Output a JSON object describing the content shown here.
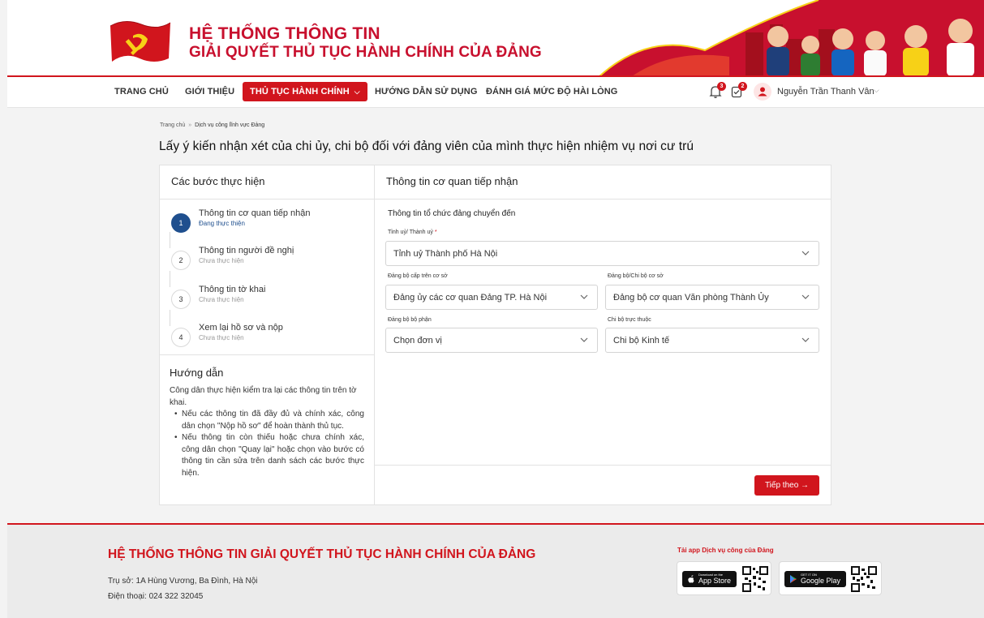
{
  "header": {
    "brand_line1": "HỆ THỐNG THÔNG TIN",
    "brand_line2": "GIẢI QUYẾT THỦ TỤC HÀNH CHÍNH CỦA ĐẢNG"
  },
  "nav": {
    "items": [
      "TRANG CHỦ",
      "GIỚI THIỆU",
      "THỦ TỤC HÀNH CHÍNH",
      "HƯỚNG DẪN SỬ DỤNG",
      "ĐÁNH GIÁ MỨC ĐỘ HÀI LÒNG"
    ],
    "notifications_count": "3",
    "tasks_count": "2",
    "user_name": "Nguyễn Trần Thanh Vân"
  },
  "breadcrumb": {
    "home": "Trang chủ",
    "separator": "»",
    "current": "Dịch vụ công lĩnh vực Đảng"
  },
  "page_title": "Lấy ý kiến nhận xét của chi ủy, chi bộ đối với đảng viên của mình thực hiện nhiệm vụ nơi cư trú",
  "steps": {
    "heading": "Các bước thực hiện",
    "items": [
      {
        "num": "1",
        "title": "Thông tin cơ quan tiếp nhận",
        "status": "Đang thực thiện"
      },
      {
        "num": "2",
        "title": "Thông tin người đề nghị",
        "status": "Chưa thực hiện"
      },
      {
        "num": "3",
        "title": "Thông tin tờ khai",
        "status": "Chưa thực hiện"
      },
      {
        "num": "4",
        "title": "Xem lại hồ sơ và nộp",
        "status": "Chưa thực hiện"
      }
    ]
  },
  "guide": {
    "title": "Hướng dẫn",
    "intro": "Công dân thực hiện kiểm tra lại các thông tin trên tờ khai.",
    "bullets": [
      "Nếu các thông tin đã đầy đủ và chính xác, công dân chọn \"Nộp hồ sơ\" để hoàn thành thủ tục.",
      "Nếu thông tin còn thiếu hoặc chưa chính xác, công dân chọn \"Quay lại\" hoặc chọn vào bước có thông tin cần sửa trên danh sách các bước thực hiện."
    ]
  },
  "form": {
    "heading": "Thông tin cơ quan tiếp nhận",
    "section_title": "Thông tin tổ chức đảng chuyển đến",
    "fields": {
      "tinh_uy": {
        "label": "Tỉnh uỷ/ Thành uỷ",
        "required": "*",
        "value": "Tỉnh uỷ Thành phố Hà Nội"
      },
      "dang_bo_cap_tren": {
        "label": "Đảng bộ cấp trên cơ sở",
        "value": "Đảng ủy các cơ quan Đảng TP. Hà Nội"
      },
      "dang_bo_co_so": {
        "label": "Đảng bộ/Chi bộ cơ sở",
        "value": "Đảng bộ cơ quan Văn phòng Thành Ủy"
      },
      "dang_bo_bo_phan": {
        "label": "Đảng bộ bộ phận",
        "value": "Chọn đơn vị"
      },
      "chi_bo": {
        "label": "Chi bộ trực thuộc",
        "value": "Chi bộ Kinh tế"
      }
    },
    "next_label": "Tiếp theo →"
  },
  "footer": {
    "title": "HỆ THỐNG THÔNG TIN GIẢI QUYẾT THỦ TỤC HÀNH CHÍNH CỦA ĐẢNG",
    "address": "Trụ sở: 1A Hùng Vương, Ba Đình, Hà Nội",
    "phone": "Điện thoại: 024 322 32045",
    "app_title": "Tải app Dịch vụ công của Đảng",
    "app_store_small": "Download on the",
    "app_store_big": "App Store",
    "google_play_small": "GET IT ON",
    "google_play_big": "Google Play"
  },
  "colors": {
    "brand_red": "#d1151d",
    "step_active": "#1f4f8e"
  }
}
